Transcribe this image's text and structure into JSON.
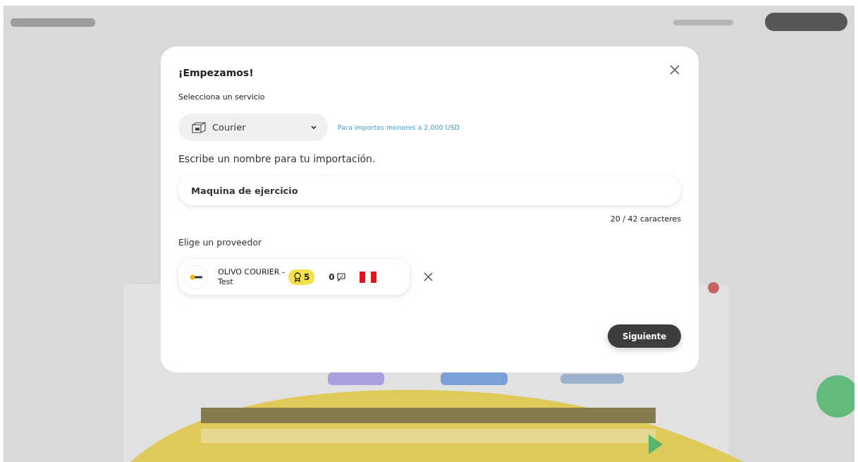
{
  "backdrop": {
    "kind": "blurred"
  },
  "dialog": {
    "title": "¡Empezamos!",
    "service_label": "Selecciona un servicio",
    "service": {
      "value": "Courier",
      "hint": "Para importes menores a 2,000 USD"
    },
    "name_prompt": "Escribe un nombre para tu importación.",
    "name_field": {
      "value": "Maquina de ejercicio"
    },
    "counter": "20 / 42 caracteres",
    "provider_prompt": "Elige un proveedor",
    "provider": {
      "name": "OLIVO COURIER - Test",
      "rating": "5",
      "comments": "0"
    },
    "next_button": "Siguiente"
  }
}
